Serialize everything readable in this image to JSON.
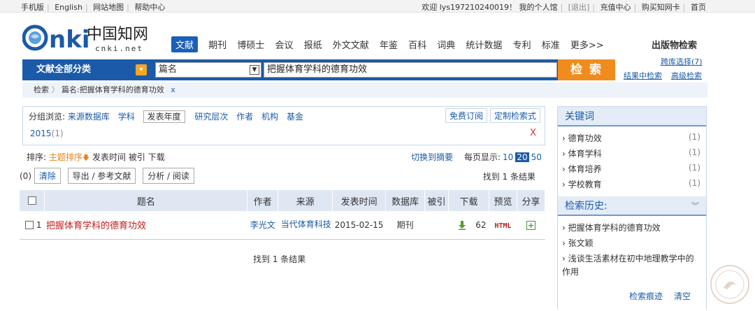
{
  "topbar": {
    "mobile": "手机版",
    "english": "English",
    "sitemap": "网站地图",
    "help": "帮助中心",
    "welcome": "欢迎 lys197210240019！",
    "my_library": "我的个人馆",
    "logout": "[退出]",
    "recharge": "充值中心",
    "buy_card": "购买知网卡",
    "home": "首页"
  },
  "logo": {
    "text": "中国知网",
    "sub": "cnki.net"
  },
  "nav": {
    "items": [
      "文献",
      "期刊",
      "博硕士",
      "会议",
      "报纸",
      "外文文献",
      "年鉴",
      "百科",
      "词典",
      "统计数据",
      "专利",
      "标准",
      "更多>>"
    ],
    "active": "文献",
    "publication_search": "出版物检索"
  },
  "search": {
    "category": "文献全部分类",
    "field": "篇名",
    "query": "把握体育学科的德育功效",
    "button": "检 索",
    "cross_db": "跨库选择(7)",
    "within_results": "结果中检索",
    "advanced": "高级检索"
  },
  "breadcrumb": {
    "root": "检索",
    "sep": "〉",
    "current": "篇名:把握体育学科的德育功效",
    "close": "x"
  },
  "grouping": {
    "label": "分组浏览:",
    "links": [
      "来源数据库",
      "学科"
    ],
    "active_tab": "发表年度",
    "links2": [
      "研究层次",
      "作者",
      "机构",
      "基金"
    ],
    "free_subscribe": "免费订阅",
    "custom_search": "定制检索式",
    "filter_value": "2015",
    "filter_count": "(1)",
    "filter_close": "X"
  },
  "sort": {
    "label": "排序:",
    "topic": "主题排序",
    "topic_arrow": "🡇",
    "options": [
      "发表时间",
      "被引",
      "下载"
    ],
    "switch": "切换到摘要",
    "per_page_label": "每页显示:",
    "per_page": [
      "10",
      "20",
      "50"
    ],
    "per_page_selected": "20"
  },
  "actions": {
    "count": "(0)",
    "clear": "清除",
    "export": "导出 / 参考文献",
    "analyze": "分析 / 阅读",
    "found": "找到 1 条结果"
  },
  "table": {
    "headers": [
      "题名",
      "作者",
      "来源",
      "发表时间",
      "数据库",
      "被引",
      "下载",
      "预览",
      "分享"
    ],
    "rows": [
      {
        "index": "1",
        "title": "把握体育学科的德育功效",
        "author": "李光文",
        "source": "当代体育科技",
        "date": "2015-02-15",
        "database": "期刊",
        "cited": "",
        "downloads": "62",
        "preview": "HTML",
        "share": "+"
      }
    ],
    "found_bottom": "找到 1 条结果"
  },
  "sidebar": {
    "keywords_title": "关键词",
    "keywords": [
      {
        "label": "德育功效",
        "count": "(1)"
      },
      {
        "label": "体育学科",
        "count": "(1)"
      },
      {
        "label": "体育培养",
        "count": "(1)"
      },
      {
        "label": "学校教育",
        "count": "(1)"
      }
    ],
    "history_title": "检索历史:",
    "history": [
      "把握体育学科的德育功效",
      "张文颖",
      "浅谈生活素材在初中地理教学中的作用"
    ],
    "history_trace": "检索痕迹",
    "history_clear": "清空"
  },
  "colors": {
    "brand_blue": "#1b5aa8",
    "search_orange": "#f08c1e",
    "title_red": "#c41b1b"
  }
}
